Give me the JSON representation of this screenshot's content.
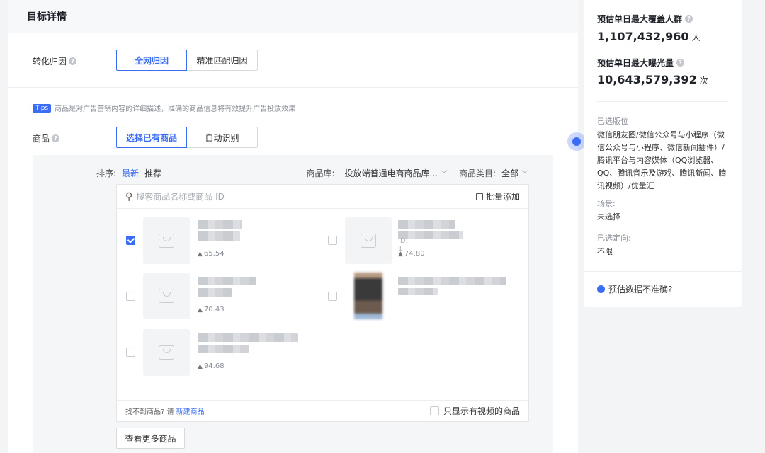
{
  "header": {
    "title": "目标详情"
  },
  "attribution": {
    "label": "转化归因",
    "options": [
      "全网归因",
      "精准匹配归因"
    ],
    "selected": "全网归因"
  },
  "tips": {
    "badge": "Tips",
    "text": "商品是对广告营销内容的详细描述，准确的商品信息将有效提升广告投放效果"
  },
  "goods": {
    "label": "商品",
    "options": [
      "选择已有商品",
      "自动识别"
    ],
    "selected": "选择已有商品"
  },
  "sortbar": {
    "sort_label": "排序:",
    "sort_options": [
      "最新",
      "推荐"
    ],
    "sort_selected": "最新",
    "library_label": "商品库:",
    "library_value": "投放端普通电商商品库...",
    "category_label": "商品类目:",
    "category_value": "全部"
  },
  "search": {
    "placeholder": "搜索商品名称或商品 ID",
    "batch_add": "批量添加"
  },
  "items": [
    {
      "heat": "65.54",
      "checked": true
    },
    {
      "heat": "74.80",
      "checked": false,
      "id_text": "ID: 1"
    },
    {
      "heat": "70.43",
      "checked": false
    },
    {
      "heat": "",
      "checked": false
    },
    {
      "heat": "94.68",
      "checked": false
    }
  ],
  "list_footer": {
    "not_found": "找不到商品? 请",
    "create_link": "新建商品",
    "video_only": "只显示有视频的商品"
  },
  "more_button": "查看更多商品",
  "side": {
    "reach_title": "预估单日最大覆盖人群",
    "reach_value": "1,107,432,960",
    "reach_unit": "人",
    "exposure_title": "预估单日最大曝光量",
    "exposure_value": "10,643,579,392",
    "exposure_unit": "次",
    "placement_label": "已选版位",
    "placement_value": "微信朋友圈/微信公众号与小程序（微信公众号与小程序、微信新闻插件）/腾讯平台与内容媒体（QQ浏览器、QQ、腾讯音乐及游戏、腾讯新闻、腾讯视频）/优量汇",
    "scene_label": "场景:",
    "scene_value": "未选择",
    "targeting_label": "已选定向:",
    "targeting_value": "不限",
    "inaccurate_q": "预估数据不准确?"
  },
  "colors": {
    "accent": "#3a6cf4",
    "panel_bg": "#f5f6f8"
  }
}
